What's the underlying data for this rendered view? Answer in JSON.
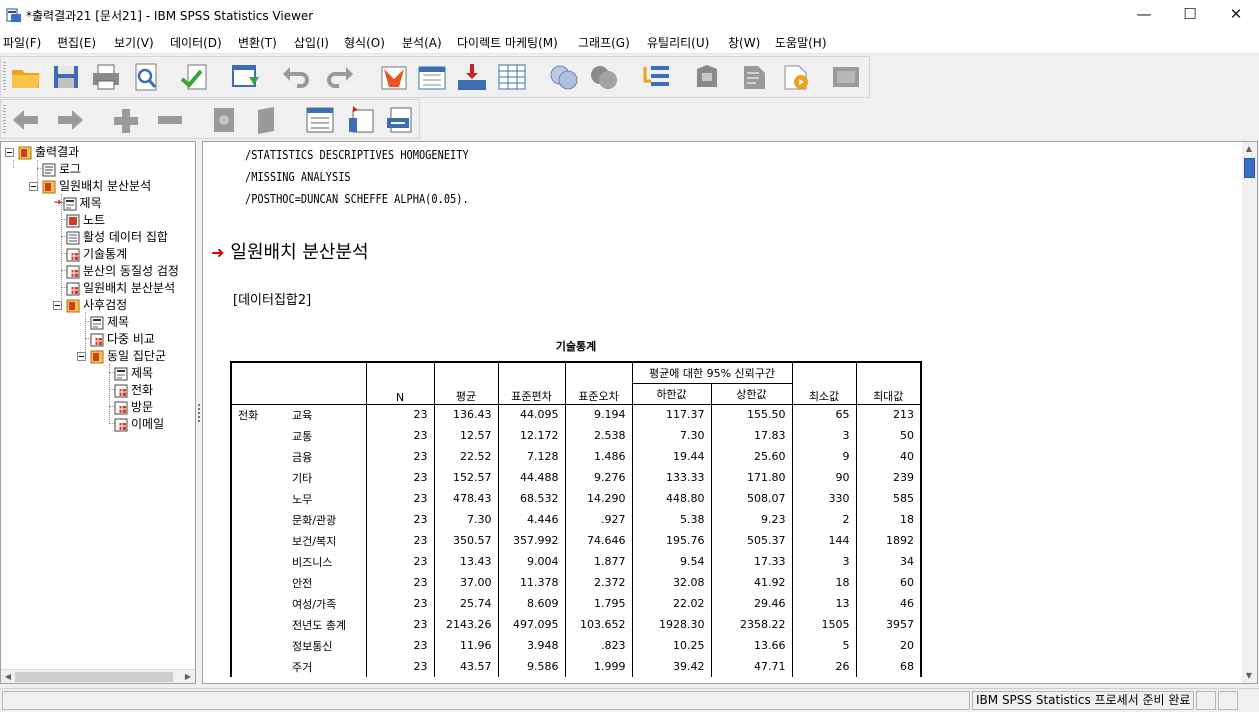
{
  "window": {
    "title": "*출력결과21 [문서21] - IBM SPSS Statistics Viewer",
    "minimize": "—",
    "maximize": "☐",
    "close": "✕"
  },
  "menu": [
    "파일(F)",
    "편집(E)",
    "보기(V)",
    "데이터(D)",
    "변환(T)",
    "삽입(I)",
    "형식(O)",
    "분석(A)",
    "다이렉트 마케팅(M)",
    "그래프(G)",
    "유틸리티(U)",
    "창(W)",
    "도움말(H)"
  ],
  "toolbar1_icons": [
    "open-folder-icon",
    "save-icon",
    "print-icon",
    "print-preview-icon",
    "export-icon",
    "recall-dialog-icon",
    "undo-icon",
    "redo-icon",
    "goto-data-icon",
    "goto-case-icon",
    "variables-icon",
    "data-editor-icon",
    "select-icon",
    "split-icon",
    "designate-window-icon",
    "run-script-icon",
    "show-all-icon",
    "hide-icon",
    "insert-icon",
    "output-icon"
  ],
  "toolbar2_icons": [
    "back-icon",
    "forward-icon",
    "expand-icon",
    "collapse-icon",
    "show-icon",
    "hide-icon",
    "insert-heading-icon",
    "insert-title-icon",
    "insert-text-icon"
  ],
  "outline": [
    {
      "label": "출력결과",
      "level": 0,
      "icon": "book-icon",
      "expander": true
    },
    {
      "label": "로그",
      "level": 1,
      "icon": "log-icon"
    },
    {
      "label": "일원배치 분산분석",
      "level": 1,
      "icon": "book-icon",
      "expander": true
    },
    {
      "label": "제목",
      "level": 2,
      "icon": "title-icon",
      "selected": true
    },
    {
      "label": "노트",
      "level": 2,
      "icon": "notes-icon"
    },
    {
      "label": "활성 데이터 집합",
      "level": 2,
      "icon": "text-icon"
    },
    {
      "label": "기술통계",
      "level": 2,
      "icon": "table-icon"
    },
    {
      "label": "분산의 동질성 검정",
      "level": 2,
      "icon": "table-icon"
    },
    {
      "label": "일원배치 분산분석",
      "level": 2,
      "icon": "table-icon"
    },
    {
      "label": "사후검정",
      "level": 2,
      "icon": "book-icon",
      "expander": true
    },
    {
      "label": "제목",
      "level": 3,
      "icon": "title-icon"
    },
    {
      "label": "다중 비교",
      "level": 3,
      "icon": "table-icon"
    },
    {
      "label": "동일 집단군",
      "level": 3,
      "icon": "book-icon",
      "expander": true
    },
    {
      "label": "제목",
      "level": 4,
      "icon": "title-icon"
    },
    {
      "label": "전화",
      "level": 4,
      "icon": "table-icon"
    },
    {
      "label": "방문",
      "level": 4,
      "icon": "table-icon"
    },
    {
      "label": "이메일",
      "level": 4,
      "icon": "table-icon"
    }
  ],
  "syntax_lines": [
    "/STATISTICS DESCRIPTIVES HOMOGENEITY",
    "/MISSING ANALYSIS",
    "/POSTHOC=DUNCAN SCHEFFE ALPHA(0.05)."
  ],
  "heading": "일원배치 분산분석",
  "dataset": "[데이터집합2]",
  "table": {
    "title": "기술통계",
    "ci_header": "평균에 대한 95% 신뢰구간",
    "columns": [
      "N",
      "평균",
      "표준편차",
      "표준오차",
      "하한값",
      "상한값",
      "최소값",
      "최대값"
    ],
    "group_label": "전화",
    "rows": [
      {
        "cat": "교육",
        "vals": [
          "23",
          "136.43",
          "44.095",
          "9.194",
          "117.37",
          "155.50",
          "65",
          "213"
        ]
      },
      {
        "cat": "교통",
        "vals": [
          "23",
          "12.57",
          "12.172",
          "2.538",
          "7.30",
          "17.83",
          "3",
          "50"
        ]
      },
      {
        "cat": "금융",
        "vals": [
          "23",
          "22.52",
          "7.128",
          "1.486",
          "19.44",
          "25.60",
          "9",
          "40"
        ]
      },
      {
        "cat": "기타",
        "vals": [
          "23",
          "152.57",
          "44.488",
          "9.276",
          "133.33",
          "171.80",
          "90",
          "239"
        ]
      },
      {
        "cat": "노무",
        "vals": [
          "23",
          "478.43",
          "68.532",
          "14.290",
          "448.80",
          "508.07",
          "330",
          "585"
        ]
      },
      {
        "cat": "문화/관광",
        "vals": [
          "23",
          "7.30",
          "4.446",
          ".927",
          "5.38",
          "9.23",
          "2",
          "18"
        ]
      },
      {
        "cat": "보건/복지",
        "vals": [
          "23",
          "350.57",
          "357.992",
          "74.646",
          "195.76",
          "505.37",
          "144",
          "1892"
        ]
      },
      {
        "cat": "비즈니스",
        "vals": [
          "23",
          "13.43",
          "9.004",
          "1.877",
          "9.54",
          "17.33",
          "3",
          "34"
        ]
      },
      {
        "cat": "안전",
        "vals": [
          "23",
          "37.00",
          "11.378",
          "2.372",
          "32.08",
          "41.92",
          "18",
          "60"
        ]
      },
      {
        "cat": "여성/가족",
        "vals": [
          "23",
          "25.74",
          "8.609",
          "1.795",
          "22.02",
          "29.46",
          "13",
          "46"
        ]
      },
      {
        "cat": "전년도 총계",
        "vals": [
          "23",
          "2143.26",
          "497.095",
          "103.652",
          "1928.30",
          "2358.22",
          "1505",
          "3957"
        ]
      },
      {
        "cat": "정보통신",
        "vals": [
          "23",
          "11.96",
          "3.948",
          ".823",
          "10.25",
          "13.66",
          "5",
          "20"
        ]
      },
      {
        "cat": "주거",
        "vals": [
          "23",
          "43.57",
          "9.586",
          "1.999",
          "39.42",
          "47.71",
          "26",
          "68"
        ]
      }
    ]
  },
  "status": {
    "processor": "IBM SPSS Statistics 프로세서 준비 완료"
  }
}
